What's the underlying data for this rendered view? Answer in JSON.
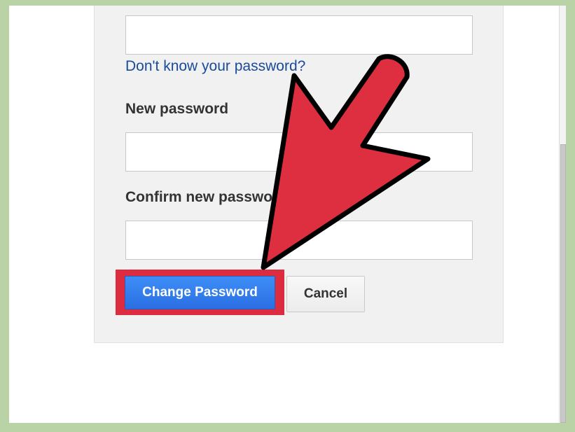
{
  "form": {
    "current_password_value": "",
    "forgot_link": "Don't know your password?",
    "new_password_label": "New password",
    "new_password_value": "",
    "confirm_label": "Confirm new password",
    "confirm_value": "",
    "change_button": "Change Password",
    "cancel_button": "Cancel"
  },
  "annotation": {
    "arrow_color": "#dd2f3f",
    "highlight_color": "#dd2b3f"
  },
  "colors": {
    "link": "#1a4a9a",
    "primary_button": "#2f7be8",
    "panel_background": "#f1f1f1"
  }
}
